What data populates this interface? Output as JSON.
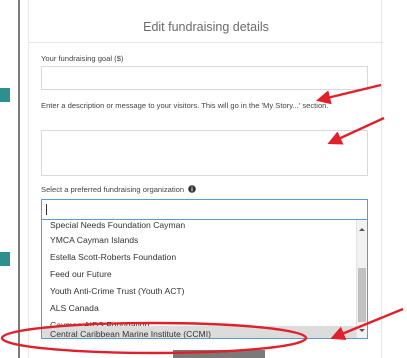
{
  "modal": {
    "title": "Edit fundraising details",
    "goal_label": "Your fundraising goal ($)",
    "goal_value": "",
    "description_label": "Enter a description or message to your visitors. This will go in the 'My Story...' section.",
    "description_value": "",
    "org_label": "Select a preferred fundraising organization",
    "org_info_icon": "info-circle-icon",
    "org_input_value": "",
    "org_options": [
      "Special Needs Foundation Cayman",
      "YMCA Cayman Islands",
      "Estella Scott-Roberts Foundation",
      "Feed our Future",
      "Youth Anti-Crime Trust (Youth ACT)",
      "ALS Canada",
      "Cayman AIDS Foundation",
      "Central Caribbean Marine Institute (CCMI)"
    ],
    "highlighted_option_index": 7
  },
  "annotation": {
    "color": "#e0202a"
  },
  "colors": {
    "focus_border": "#5b9bd5",
    "rail_accent": "#2d8f8f"
  }
}
